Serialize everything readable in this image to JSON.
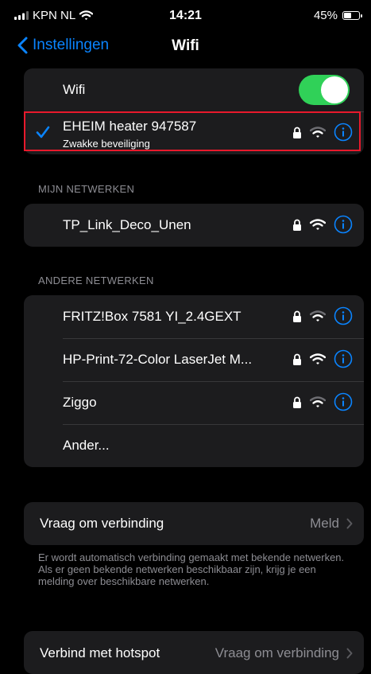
{
  "status_bar": {
    "carrier": "KPN NL",
    "time": "14:21",
    "battery_percent": "45%",
    "battery_level": 0.45
  },
  "nav": {
    "back_label": "Instellingen",
    "title": "Wifi"
  },
  "wifi_toggle": {
    "label": "Wifi",
    "on": true
  },
  "connected_network": {
    "name": "EHEIM heater 947587",
    "subtitle": "Zwakke beveiliging"
  },
  "my_networks": {
    "header": "MIJN NETWERKEN",
    "items": [
      {
        "name": "TP_Link_Deco_Unen"
      }
    ]
  },
  "other_networks": {
    "header": "ANDERE NETWERKEN",
    "items": [
      {
        "name": "FRITZ!Box 7581 YI_2.4GEXT"
      },
      {
        "name": "HP-Print-72-Color LaserJet M..."
      },
      {
        "name": "Ziggo"
      }
    ],
    "other_label": "Ander..."
  },
  "ask_to_join": {
    "label": "Vraag om verbinding",
    "value": "Meld",
    "footer": "Er wordt automatisch verbinding gemaakt met bekende netwerken. Als er geen bekende netwerken beschikbaar zijn, krijg je een melding over beschikbare netwerken."
  },
  "hotspot": {
    "label": "Verbind met hotspot",
    "value": "Vraag om verbinding"
  },
  "colors": {
    "accent": "#0a84ff",
    "toggle_on": "#30d158",
    "highlight": "#e8192c",
    "cell_bg": "#1c1c1e"
  },
  "icons": [
    "signal-bars-icon",
    "wifi-icon",
    "battery-icon",
    "chevron-left-icon",
    "checkmark-icon",
    "lock-icon",
    "info-icon",
    "chevron-right-icon"
  ]
}
